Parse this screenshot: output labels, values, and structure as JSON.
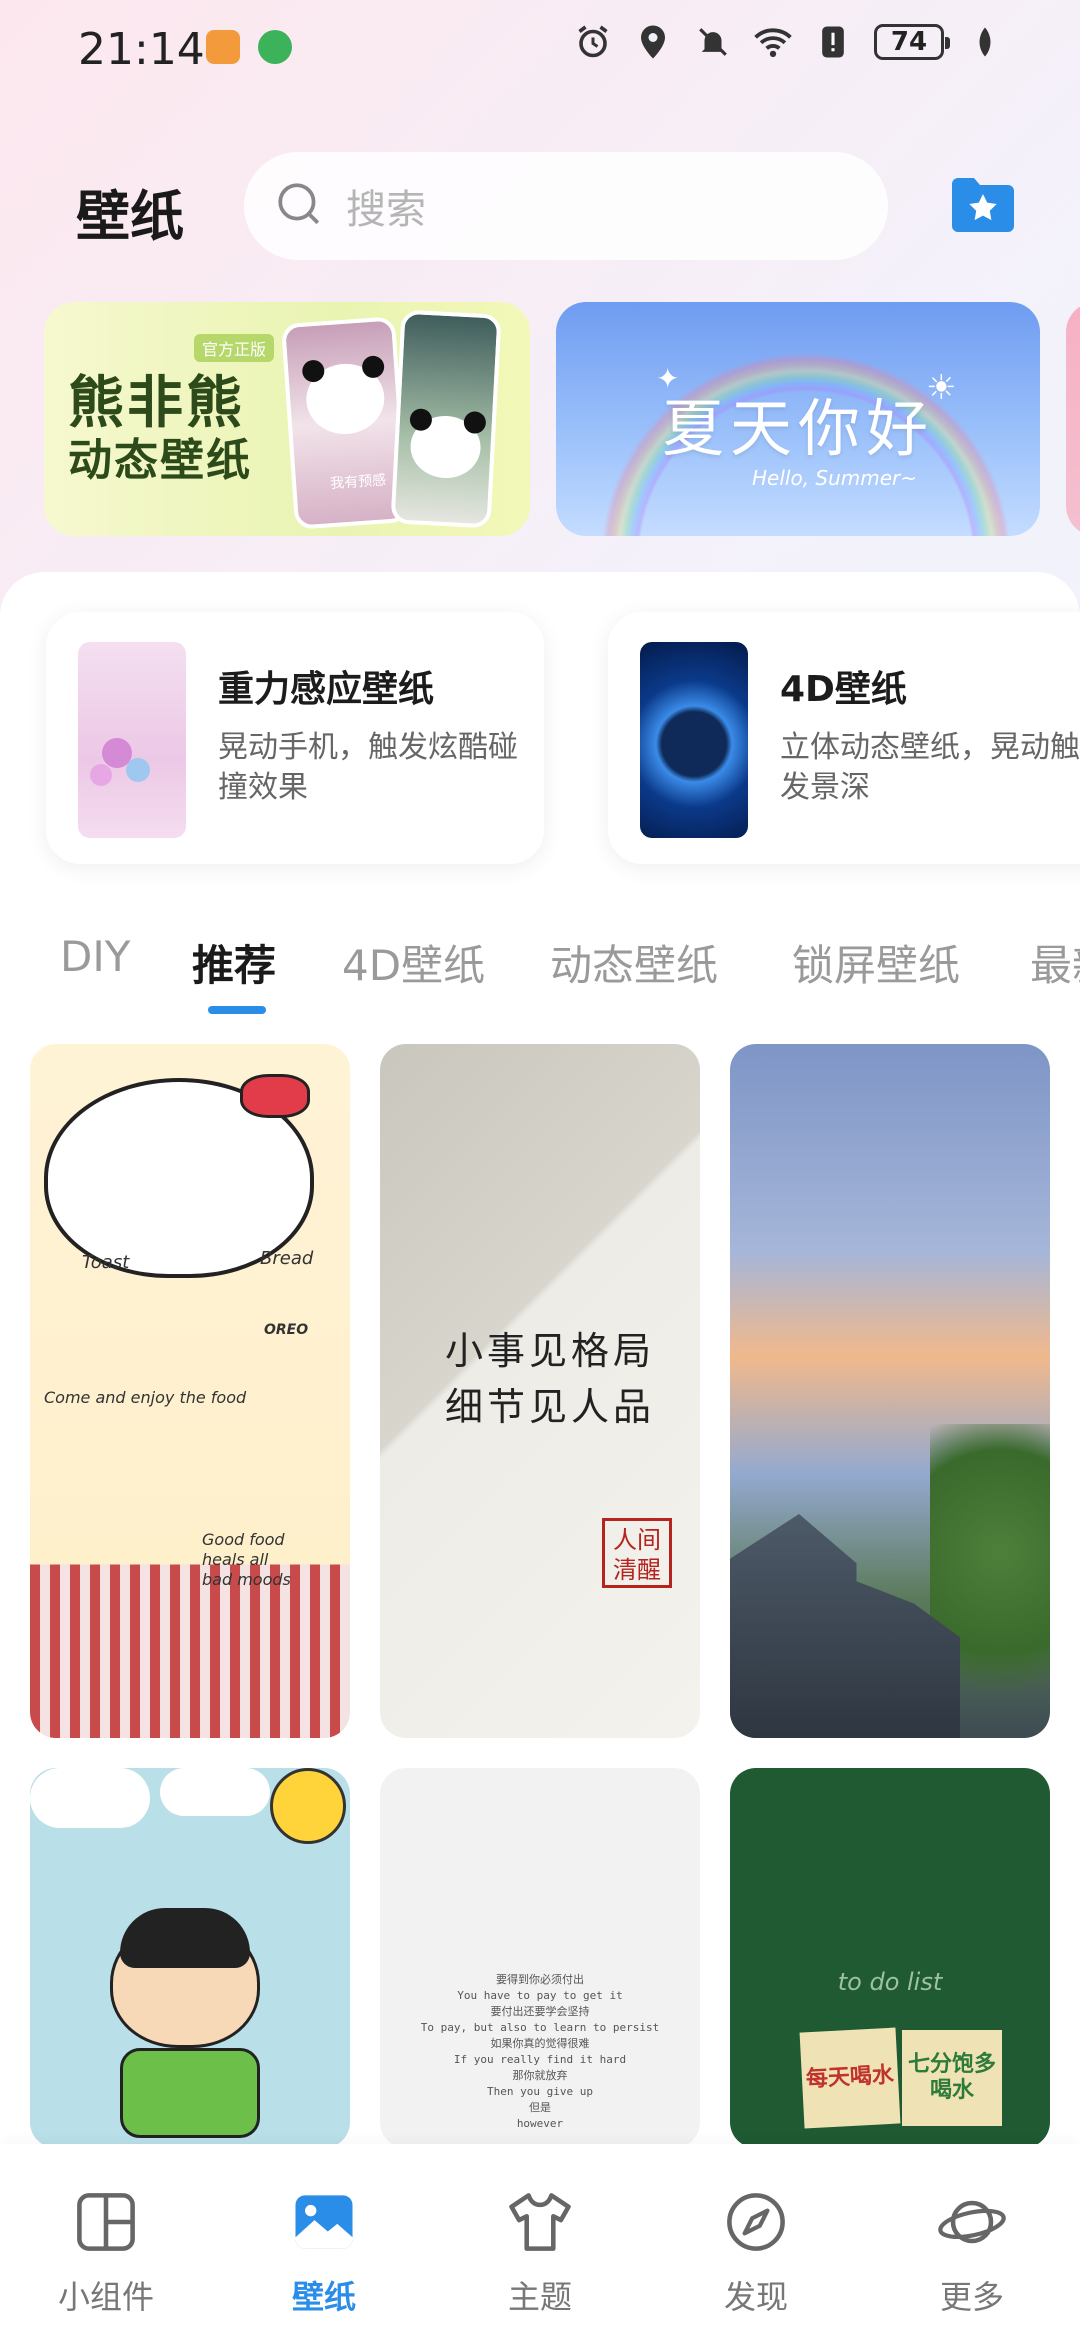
{
  "status_bar": {
    "time": "21:14",
    "battery": "74",
    "icons": [
      "alarm-icon",
      "location-icon",
      "mute-icon",
      "wifi-icon",
      "alert-icon",
      "battery-icon",
      "leaf-icon"
    ]
  },
  "header": {
    "title": "壁纸",
    "search_placeholder": "搜索"
  },
  "banners": [
    {
      "title": "熊非熊",
      "subtitle": "动态壁纸",
      "badge": "官方正版",
      "card_caption": "我有预感"
    },
    {
      "title": "夏天你好",
      "subtitle": "Hello, Summer~"
    }
  ],
  "features": [
    {
      "title": "重力感应壁纸",
      "desc": "晃动手机，触发炫酷碰撞效果"
    },
    {
      "title": "4D壁纸",
      "desc": "立体动态壁纸，晃动触发景深"
    }
  ],
  "tabs": [
    "DIY",
    "推荐",
    "4D壁纸",
    "动态壁纸",
    "锁屏壁纸",
    "最新"
  ],
  "active_tab": "推荐",
  "wallpapers": {
    "tile1_words": [
      "Toast",
      "Bread",
      "Come and enjoy the food",
      "Good food heals all bad moods",
      "OREO"
    ],
    "tile2_lines": [
      "小事见格局",
      "细节见人品"
    ],
    "tile2_seal": "人间清醒",
    "tile5_poem": [
      "要得到你必须付出",
      "You have to pay to get it",
      "要付出还要学会坚持",
      "To pay, but also to learn to persist",
      "如果你真的觉得很难",
      "If you really find it hard",
      "那你就放弃",
      "Then you give up",
      "但是",
      "however"
    ],
    "tile6_title": "to do list",
    "tile6_note1": "每天喝水",
    "tile6_note2": "七分饱多喝水"
  },
  "bottom_nav": [
    {
      "label": "小组件",
      "icon": "widget-icon"
    },
    {
      "label": "壁纸",
      "icon": "wallpaper-icon"
    },
    {
      "label": "主题",
      "icon": "theme-shirt-icon"
    },
    {
      "label": "发现",
      "icon": "compass-icon"
    },
    {
      "label": "更多",
      "icon": "planet-icon"
    }
  ],
  "active_nav": "壁纸",
  "colors": {
    "accent": "#2a8ee8",
    "folder": "#2a8ee8"
  }
}
